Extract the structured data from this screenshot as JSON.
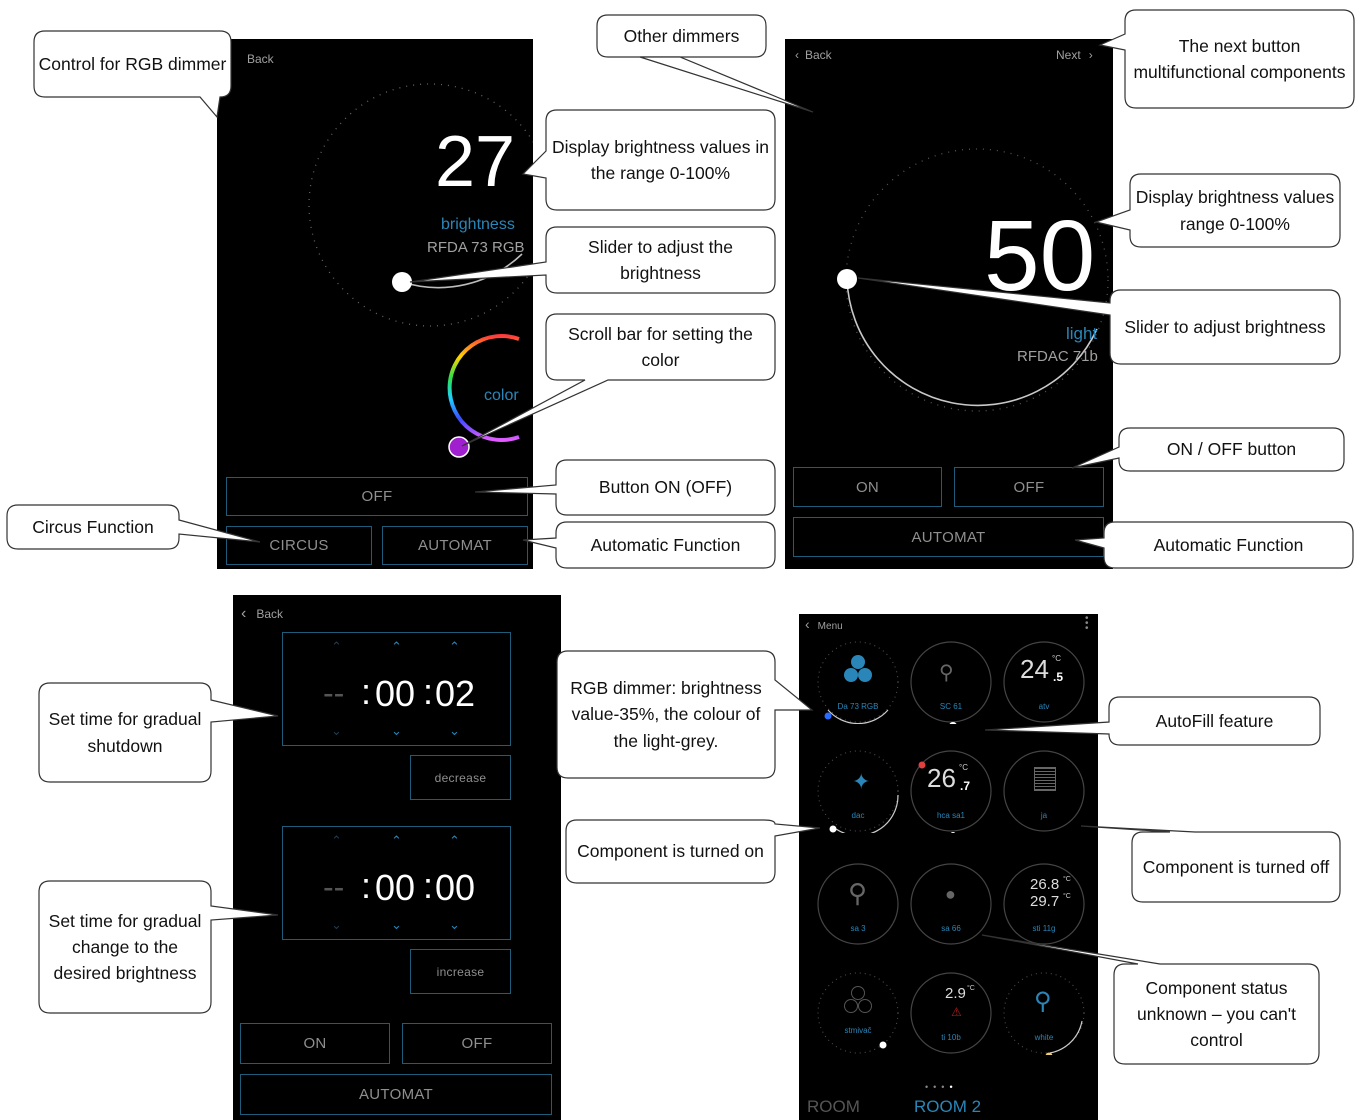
{
  "screen_rgb": {
    "back_label": "Back",
    "value": "27",
    "value_label": "brightness",
    "device_name": "RFDA 73 RGB",
    "brightness": 27,
    "color_label": "color",
    "off_label": "OFF",
    "circus_label": "CIRCUS",
    "automat_label": "AUTOMAT"
  },
  "screen_dimmer": {
    "back_label": "Back",
    "next_label": "Next",
    "value": "50",
    "value_label": "light",
    "device_name": "RFDAC 71b",
    "brightness": 50,
    "on_label": "ON",
    "off_label": "OFF",
    "automat_label": "AUTOMAT"
  },
  "screen_time": {
    "back_label": "Back",
    "timer1": {
      "dash": "--",
      "minutes": "00",
      "seconds": "02",
      "button": "decrease"
    },
    "timer2": {
      "dash": "--",
      "minutes": "00",
      "seconds": "00",
      "button": "increase"
    },
    "on_label": "ON",
    "off_label": "OFF",
    "automat_label": "AUTOMAT"
  },
  "screen_room": {
    "menu_label": "Menu",
    "tiles": [
      {
        "label": "Da 73 RGB",
        "icon": "rgb-circles-icon"
      },
      {
        "label": "SC 61",
        "icon": "lamp-outline-icon"
      },
      {
        "label": "atv",
        "value": "24",
        "unit": "°C",
        "decimal": ".5"
      },
      {
        "label": "dac",
        "icon": "bulb-icon"
      },
      {
        "label": "hca sa1",
        "value": "26",
        "unit": "°C",
        "decimal": ".7"
      },
      {
        "label": "ja",
        "icon": "blinds-icon"
      },
      {
        "label": "sa 3",
        "icon": "lamp-outline-icon"
      },
      {
        "label": "sa 66",
        "icon": "drop-icon"
      },
      {
        "label": "sti 11g",
        "value1": "26.8",
        "value2": "29.7",
        "unit": "°C"
      },
      {
        "label": "stmivač",
        "icon": "rgb-circles-icon"
      },
      {
        "label": "ti 10b",
        "value": "2.9",
        "unit": "°C"
      },
      {
        "label": "white",
        "icon": "desk-lamp-icon"
      }
    ],
    "room_tab_1": "ROOM",
    "room_tab_2": "ROOM 2"
  },
  "callouts": {
    "control_rgb": "Control for RGB dimmer",
    "display_brightness_1": "Display brightness values in the range 0-100%",
    "slider_1": "Slider to adjust the brightness",
    "scroll_color": "Scroll bar for setting the color",
    "button_onoff": "Button ON (OFF)",
    "circus": "Circus Function",
    "automatic_1": "Automatic Function",
    "other_dimmers": "Other dimmers",
    "next_button": "The next button multifunctional components",
    "display_brightness_2": "Display brightness values range 0-100%",
    "slider_2": "Slider to adjust brightness",
    "onoff_button": "ON / OFF button",
    "automatic_2": "Automatic Function",
    "set_shutdown": "Set time for gradual shutdown",
    "set_change": "Set time for gradual change to the desired brightness",
    "rgb_dimmer_info": "RGB dimmer: brightness value-35%, the colour of the light-grey.",
    "autofill": "AutoFill feature",
    "turned_on": "Component is turned on",
    "turned_off": "Component is turned off",
    "status_unknown": "Component status unknown – you can't control"
  },
  "colors": {
    "accent_blue": "#2a86b8",
    "button_border": "#1f5c79",
    "screen_bg": "#000000"
  }
}
